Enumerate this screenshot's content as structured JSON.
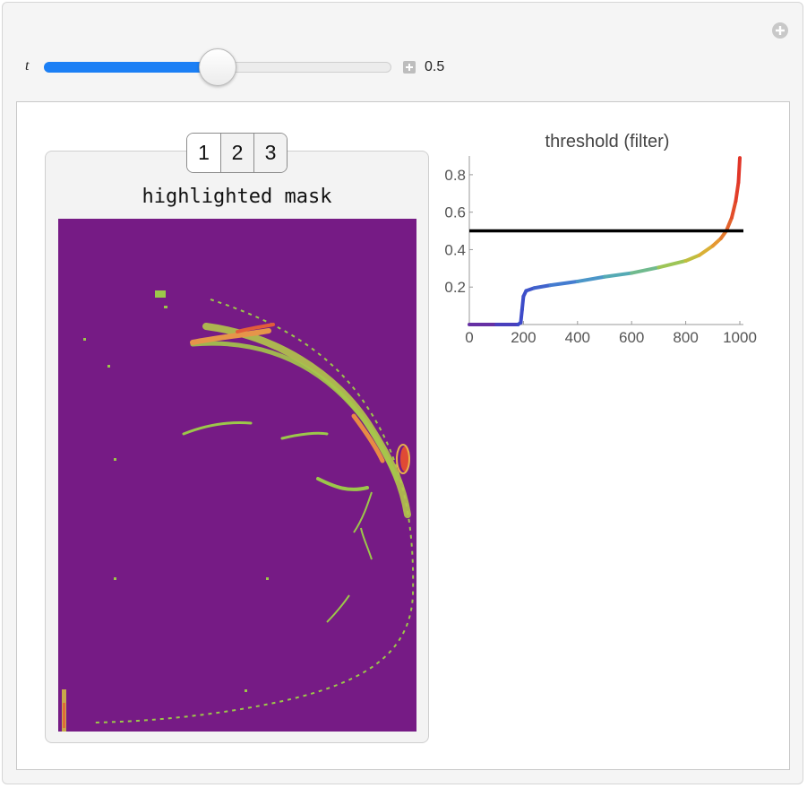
{
  "controls": {
    "param_label": "t",
    "param_value": "0.5",
    "param_fraction": 0.5
  },
  "tabs": [
    {
      "label": "1",
      "selected": true
    },
    {
      "label": "2",
      "selected": false
    },
    {
      "label": "3",
      "selected": false
    }
  ],
  "mask_panel": {
    "title": "highlighted mask",
    "background_color": "#761b85"
  },
  "chart_data": {
    "type": "line",
    "title": "threshold (filter)",
    "xlabel": "",
    "ylabel": "",
    "xlim": [
      0,
      1000
    ],
    "ylim": [
      0,
      0.9
    ],
    "xticks": [
      "0",
      "200",
      "400",
      "600",
      "800",
      "1000"
    ],
    "yticks": [
      "0.2",
      "0.4",
      "0.6",
      "0.8"
    ],
    "grid": false,
    "threshold_line": 0.5,
    "series": [
      {
        "color_map": "rainbow",
        "points": [
          [
            0,
            0.0
          ],
          [
            100,
            0.0
          ],
          [
            180,
            0.0
          ],
          [
            190,
            0.01
          ],
          [
            195,
            0.08
          ],
          [
            200,
            0.15
          ],
          [
            210,
            0.18
          ],
          [
            240,
            0.195
          ],
          [
            300,
            0.21
          ],
          [
            400,
            0.23
          ],
          [
            500,
            0.255
          ],
          [
            600,
            0.275
          ],
          [
            700,
            0.305
          ],
          [
            800,
            0.34
          ],
          [
            850,
            0.37
          ],
          [
            900,
            0.42
          ],
          [
            930,
            0.46
          ],
          [
            950,
            0.5
          ],
          [
            970,
            0.57
          ],
          [
            985,
            0.66
          ],
          [
            995,
            0.76
          ],
          [
            1000,
            0.89
          ]
        ]
      }
    ]
  }
}
